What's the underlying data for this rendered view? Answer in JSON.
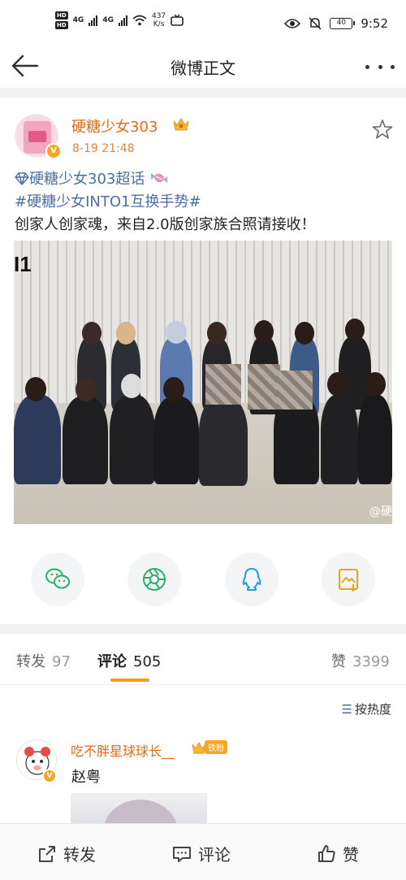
{
  "status_bar": {
    "hd1": "HD",
    "hd2": "HD",
    "net1": "4G",
    "net2": "4G",
    "speed_value": "437",
    "speed_unit": "K/s",
    "battery": "40",
    "time": "9:52"
  },
  "nav": {
    "title": "微博正文"
  },
  "post": {
    "username": "硬糖少女303",
    "time": "8-19 21:48",
    "topic1": "硬糖少女303超话",
    "topic2": "#硬糖少女INTO1互换手势#",
    "text": "创家人创家魂，来自2.0版创家族合照请接收！",
    "image_logo": "I1",
    "image_watermark": "@硬"
  },
  "tabs": {
    "repost_label": "转发",
    "repost_count": "97",
    "comment_label": "评论",
    "comment_count": "505",
    "like_label": "赞",
    "like_count": "3399"
  },
  "sort": {
    "label": "按热度"
  },
  "comment": {
    "username": "吃不胖星球球长__",
    "fan_tag": "铁粉",
    "text": "赵粤"
  },
  "bottom_bar": {
    "repost": "转发",
    "comment": "评论",
    "like": "赞"
  },
  "colors": {
    "accent_orange": "#e86a10",
    "topic_blue": "#4a6fa5",
    "tab_underline": "#f79a1f",
    "wechat_green": "#2aae67",
    "qq_blue": "#1e9fe0",
    "save_orange": "#f2a024"
  },
  "icons": [
    "back-arrow-icon",
    "more-icon",
    "star-icon",
    "wechat-icon",
    "moments-icon",
    "qq-icon",
    "save-image-icon",
    "sort-icon",
    "repost-icon",
    "comment-icon",
    "like-icon"
  ]
}
